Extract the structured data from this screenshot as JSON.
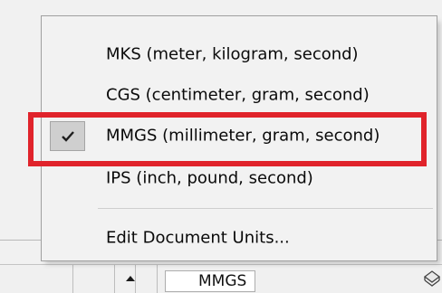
{
  "menu": {
    "items": [
      {
        "label": "MKS (meter, kilogram, second)",
        "checked": false
      },
      {
        "label": "CGS (centimeter, gram, second)",
        "checked": false
      },
      {
        "label": "MMGS (millimeter, gram, second)",
        "checked": true
      },
      {
        "label": "IPS (inch, pound, second)",
        "checked": false
      },
      {
        "label": "Edit Document Units...",
        "checked": false
      }
    ]
  },
  "status_bar": {
    "units_value": "MMGS",
    "units_caret_icon": "caret-up-icon",
    "corner_icon": "options-icon"
  },
  "colors": {
    "highlight_border": "#e0232b",
    "menu_background": "#f2f2f2",
    "check_background": "#cfcfcf"
  }
}
